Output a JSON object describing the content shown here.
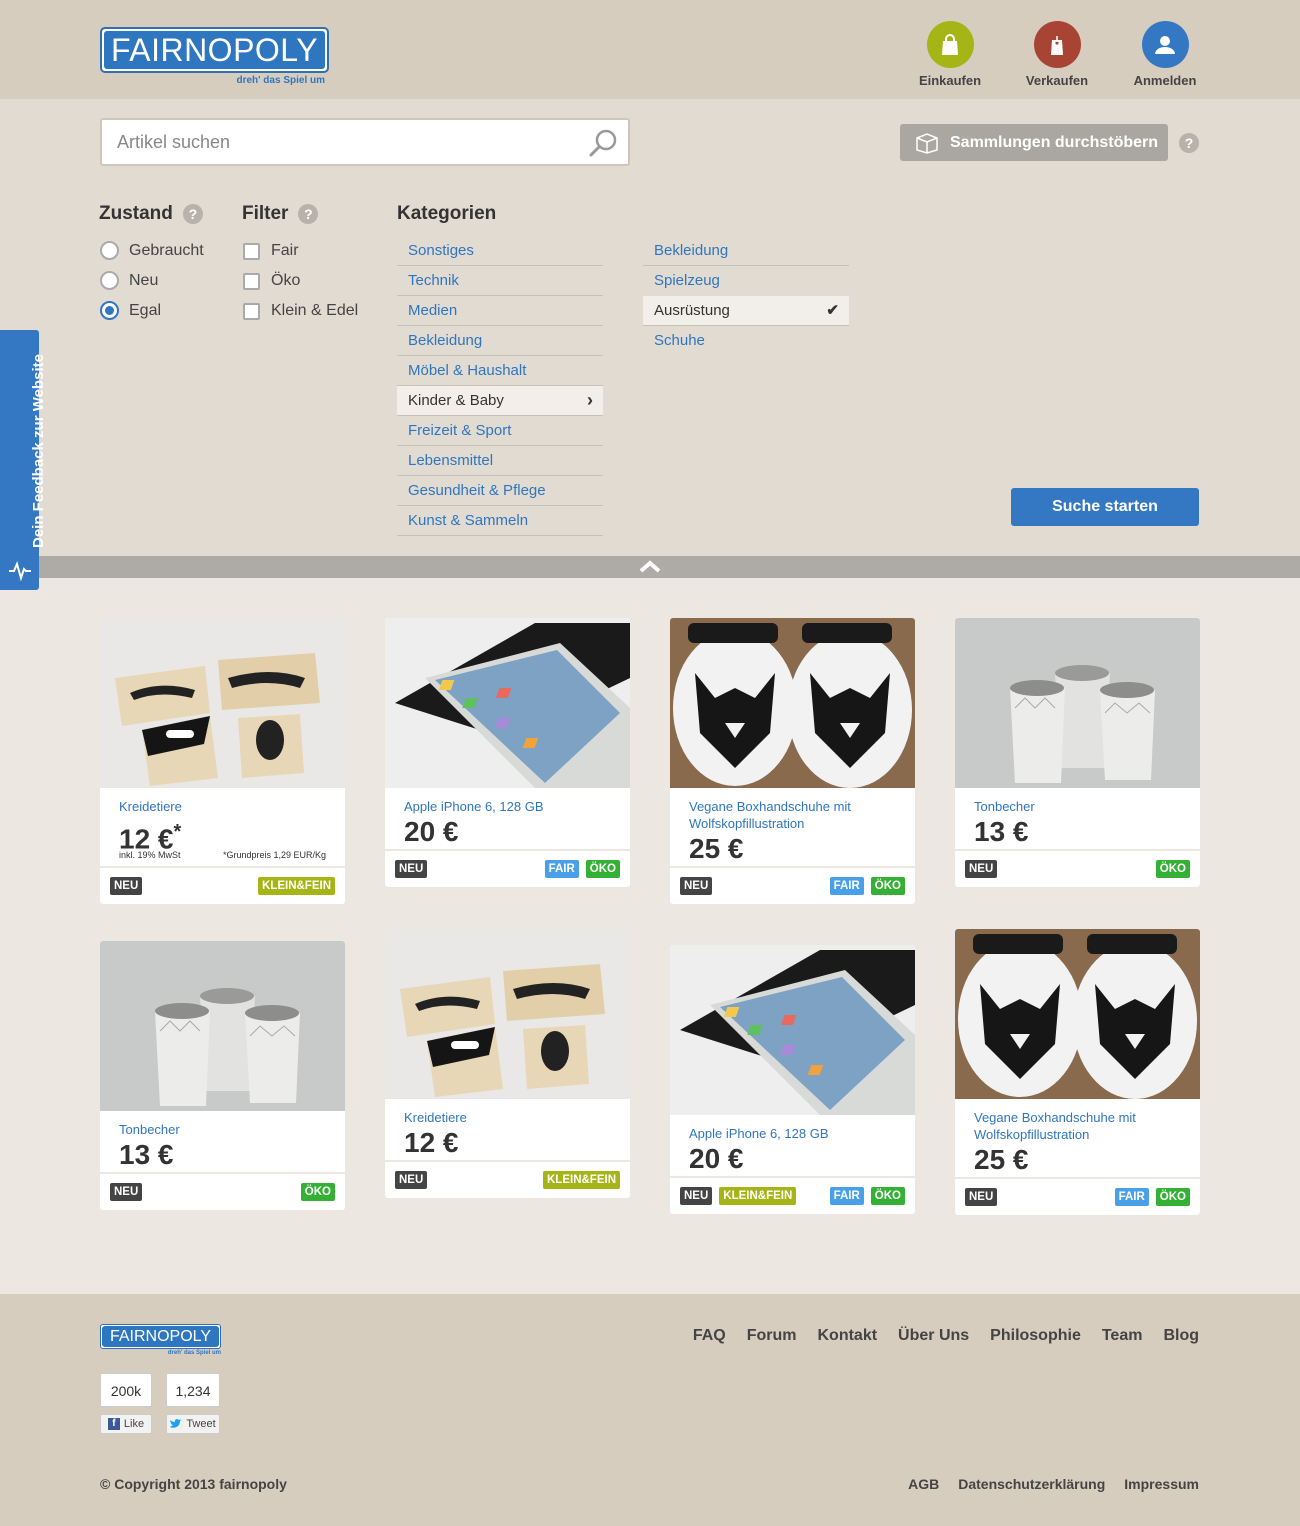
{
  "brand": {
    "name": "FAIRNOPOLY",
    "tagline": "dreh' das Spiel um",
    "color": "#2f76c0"
  },
  "nav": [
    {
      "label": "Einkaufen",
      "icon": "shopping-bag-icon",
      "color": "#a5b516"
    },
    {
      "label": "Verkaufen",
      "icon": "price-tag-icon",
      "color": "#a84434"
    },
    {
      "label": "Anmelden",
      "icon": "user-icon",
      "color": "#3478c4"
    }
  ],
  "search": {
    "placeholder": "Artikel suchen",
    "collections_label": "Sammlungen durchstöbern",
    "help": "?",
    "submit_label": "Suche starten"
  },
  "zustand": {
    "title": "Zustand",
    "help": "?",
    "options": [
      "Gebraucht",
      "Neu",
      "Egal"
    ],
    "selected": "Egal"
  },
  "filter": {
    "title": "Filter",
    "help": "?",
    "options": [
      "Fair",
      "Öko",
      "Klein & Edel"
    ]
  },
  "kategorien": {
    "title": "Kategorien",
    "main": [
      "Sonstiges",
      "Technik",
      "Medien",
      "Bekleidung",
      "Möbel & Haushalt",
      "Kinder & Baby",
      "Freizeit & Sport",
      "Lebensmittel",
      "Gesundheit & Pflege",
      "Kunst & Sammeln"
    ],
    "selected_main": "Kinder & Baby",
    "sub": [
      "Bekleidung",
      "Spielzeug",
      "Ausrüstung",
      "Schuhe"
    ],
    "selected_sub": "Ausrüstung"
  },
  "feedback": {
    "label": "Dein Feedback zur Website"
  },
  "products": [
    {
      "title": "Kreidetiere",
      "price": "12 €",
      "price_mark": "*",
      "vat": "inkl. 19% MwSt",
      "base_price": "*Grundpreis 1,29 EUR/Kg",
      "left": [
        "NEU"
      ],
      "right": [
        "KLEIN&FEIN"
      ],
      "img": "stamps"
    },
    {
      "title": "Apple iPhone 6, 128 GB",
      "price": "20 €",
      "left": [
        "NEU"
      ],
      "right": [
        "FAIR",
        "ÖKO"
      ],
      "img": "phone"
    },
    {
      "title": "Vegane Boxhandschuhe mit Wolfskopfillustration",
      "price": "25 €",
      "left": [
        "NEU"
      ],
      "right": [
        "FAIR",
        "ÖKO"
      ],
      "img": "gloves"
    },
    {
      "title": "Tonbecher",
      "price": "13 €",
      "left": [
        "NEU"
      ],
      "right": [
        "ÖKO"
      ],
      "img": "cups"
    },
    {
      "title": "Tonbecher",
      "price": "13 €",
      "left": [
        "NEU"
      ],
      "right": [
        "ÖKO"
      ],
      "img": "cups"
    },
    {
      "title": "Kreidetiere",
      "price": "12 €",
      "left": [
        "NEU"
      ],
      "right": [
        "KLEIN&FEIN"
      ],
      "img": "stamps"
    },
    {
      "title": "Apple iPhone 6, 128 GB",
      "price": "20 €",
      "left": [
        "NEU",
        "KLEIN&FEIN"
      ],
      "right": [
        "FAIR",
        "ÖKO"
      ],
      "img": "phone"
    },
    {
      "title": "Vegane Boxhandschuhe mit Wolfskopfillustration",
      "price": "25 €",
      "left": [
        "NEU"
      ],
      "right": [
        "FAIR",
        "ÖKO"
      ],
      "img": "gloves"
    }
  ],
  "badge_colors": {
    "NEU": "#444444",
    "FAIR": "#4aa0e8",
    "ÖKO": "#34b034",
    "KLEIN&FEIN": "#a5b516"
  },
  "footer": {
    "links": [
      "FAQ",
      "Forum",
      "Kontakt",
      "Über Uns",
      "Philosophie",
      "Team",
      "Blog"
    ],
    "like_count": "200k",
    "like_label": "Like",
    "tweet_count": "1,234",
    "tweet_label": "Tweet",
    "copyright": "© Copyright 2013 fairnopoly",
    "legal": [
      "AGB",
      "Datenschutzerklärung",
      "Impressum"
    ]
  }
}
